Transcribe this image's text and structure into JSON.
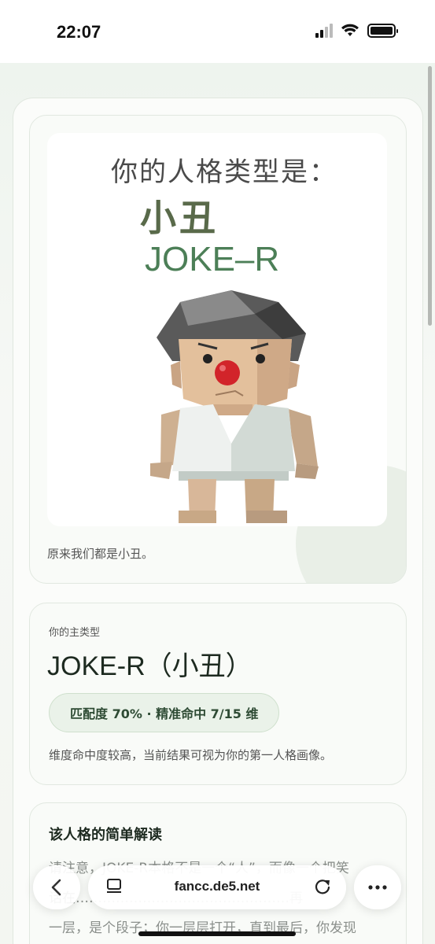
{
  "status": {
    "time": "22:07"
  },
  "hero": {
    "image_title": "你的人格类型是：",
    "image_type_cn": "小丑",
    "image_type_en": "JOKE–R",
    "caption": "原来我们都是小丑。"
  },
  "result": {
    "subtitle": "你的主类型",
    "type_name": "JOKE-R（小丑）",
    "match_pill": "匹配度 70% · 精准命中 7/15 维",
    "description": "维度命中度较高，当前结果可视为你的第一人格画像。"
  },
  "reading": {
    "title": "该人格的简单解读",
    "line1": "请注意，JOKE-R本格不是一个“人”，而像一个把笑",
    "line2": "话在…………………………………………再",
    "line3": "一层，是个段子；你一层层打开，直到最后，你发现"
  },
  "browser": {
    "url": "fancc.de5.net",
    "back_icon": "chevron-left-icon",
    "tabs_icon": "tabs-icon",
    "reload_icon": "reload-icon",
    "more_icon": "more-icon"
  },
  "colors": {
    "accent_green": "#4c7f57",
    "pill_bg": "#eaf2e9",
    "nose_red": "#d2242a"
  }
}
